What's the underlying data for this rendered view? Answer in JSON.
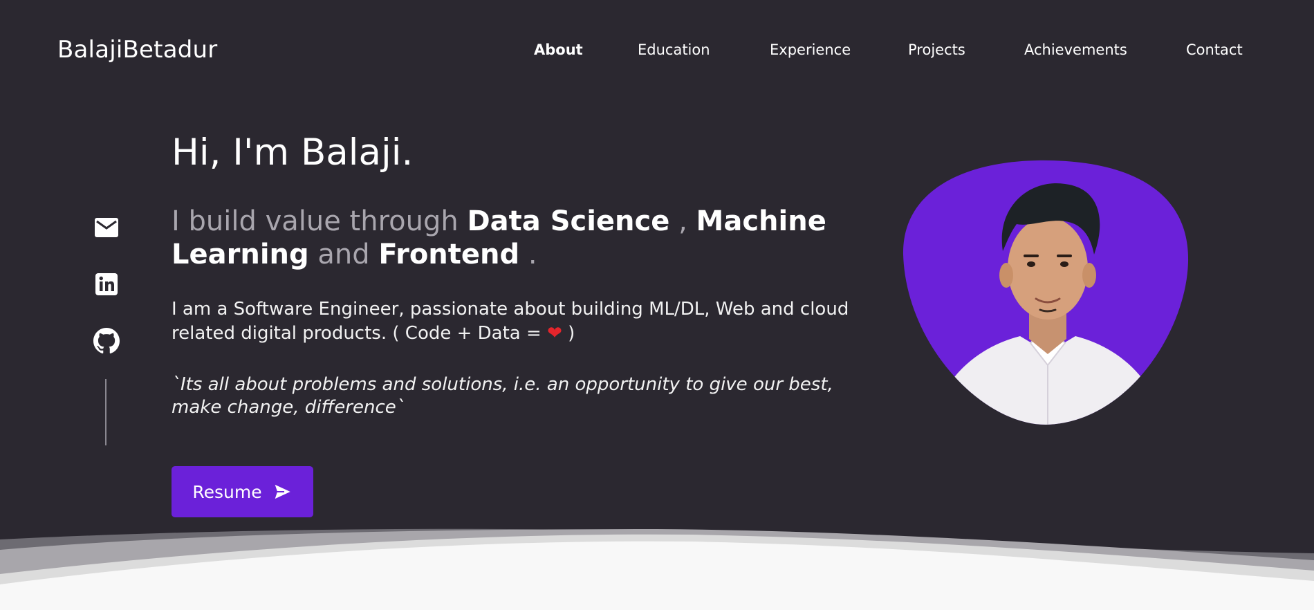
{
  "brand": "BalajiBetadur",
  "nav": [
    {
      "label": "About",
      "active": true
    },
    {
      "label": "Education",
      "active": false
    },
    {
      "label": "Experience",
      "active": false
    },
    {
      "label": "Projects",
      "active": false
    },
    {
      "label": "Achievements",
      "active": false
    },
    {
      "label": "Contact",
      "active": false
    }
  ],
  "hero": {
    "greeting": "Hi, I'm Balaji.",
    "tagline": {
      "prefix": "I build value through ",
      "skill_1": "Data Science",
      "sep_1": ", ",
      "skill_2": "Machine Learning",
      "sep_2": " and ",
      "skill_3": "Frontend",
      "end": "."
    },
    "bio_text": "I am a Software Engineer, passionate about building ML/DL, Web and cloud related digital products. ( Code + Data = ",
    "bio_end": " )",
    "quote": "`Its all about problems and solutions, i.e. an opportunity to give our best, make change, difference`",
    "resume_label": "Resume"
  },
  "social": {
    "icons": [
      "mail-icon",
      "linkedin-icon",
      "github-icon"
    ]
  },
  "colors": {
    "background": "#2b2830",
    "accent": "#6b21d9",
    "muted_text": "#a9a6ae",
    "heart": "#e4252c"
  }
}
